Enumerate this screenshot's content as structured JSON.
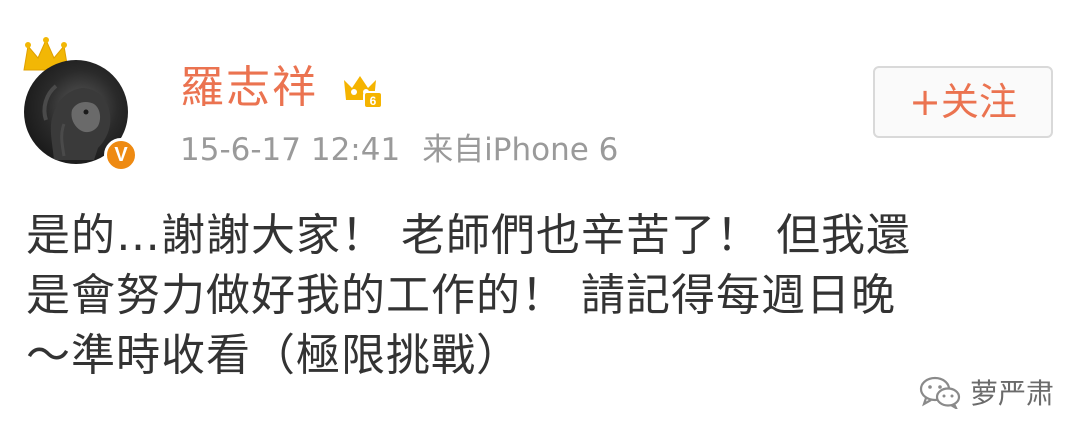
{
  "post": {
    "author": {
      "name": "羅志祥",
      "verified_badge": "V",
      "avatar_icon": "lion-avatar",
      "crown_icon": "crown-icon",
      "member_icon": "weibo-member-icon"
    },
    "timestamp": "15-6-17 12:41",
    "source": "来自iPhone 6",
    "follow_button": "+关注",
    "content_lines": [
      "是的…謝謝大家！ 老師們也辛苦了！ 但我還",
      "是會努力做好我的工作的！ 請記得每週日晚",
      "～準時收看（極限挑戰）"
    ]
  },
  "watermark": {
    "text": "萝严肃",
    "icon": "wechat-icon"
  },
  "colors": {
    "accent": "#eb7350",
    "meta_text": "#9a9a9a",
    "body_text": "#333333",
    "verified": "#ee8a12",
    "crown": "#f2b705"
  }
}
